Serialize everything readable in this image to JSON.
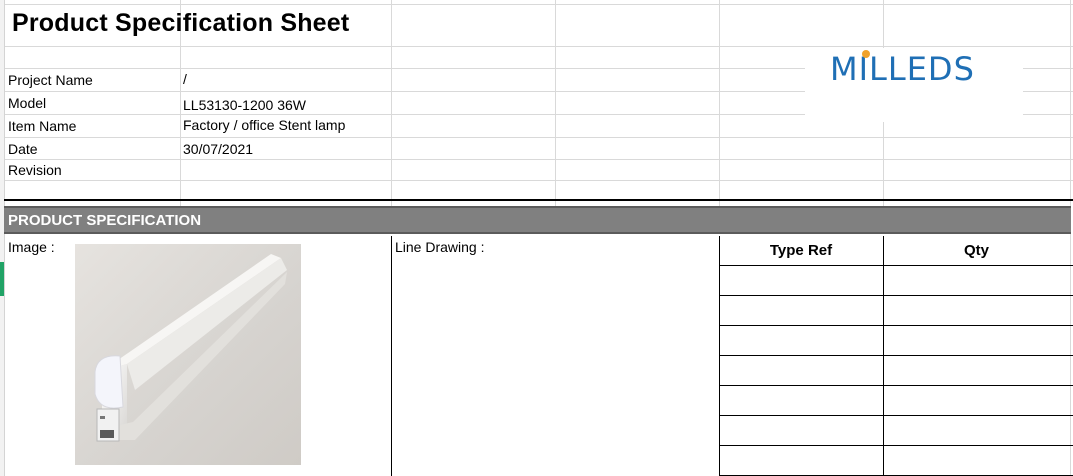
{
  "sheet": {
    "title": "Product Specification Sheet",
    "logo_text": "MILLEDS",
    "fields": [
      {
        "label": "Project Name",
        "value": "/"
      },
      {
        "label": "Model",
        "value": "LL53130-1200 36W"
      },
      {
        "label": "Item Name",
        "value": "Factory / office Stent lamp"
      },
      {
        "label": "Date",
        "value": "30/07/2021"
      },
      {
        "label": "Revision",
        "value": ""
      }
    ],
    "section_title": "PRODUCT SPECIFICATION",
    "image_label": "Image :",
    "drawing_label": "Line Drawing :",
    "table": {
      "headers": [
        "Type Ref",
        "Qty"
      ],
      "rows": 7
    }
  },
  "colors": {
    "logo": "#1f6fb5",
    "logo_accent": "#f0a22b",
    "section_bar": "#808080"
  }
}
